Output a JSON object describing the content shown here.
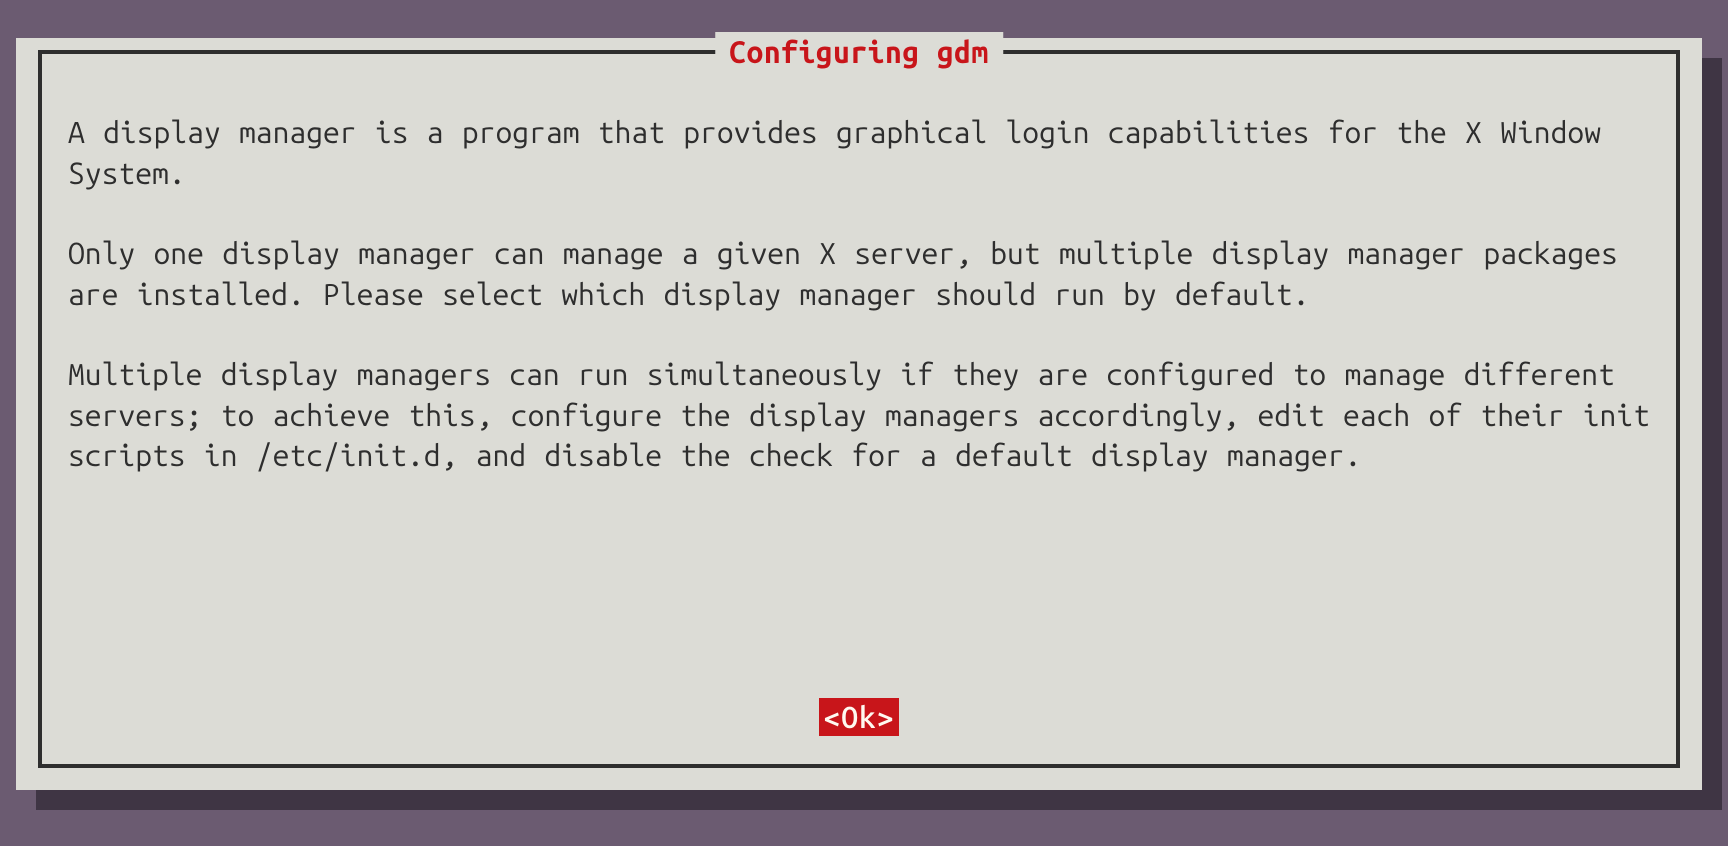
{
  "dialog": {
    "title": "Configuring gdm",
    "paragraphs": [
      "A display manager is a program that provides graphical login capabilities for the X Window System.",
      "Only one display manager can manage a given X server, but multiple display manager packages are installed. Please select which display manager should run by default.",
      "Multiple display managers can run simultaneously if they are configured to manage different servers; to achieve this, configure the display managers accordingly, edit each of their init scripts in /etc/init.d, and disable the check for a default display manager."
    ],
    "ok_label": "<Ok>"
  },
  "colors": {
    "background": "#6b5b71",
    "panel": "#dcdcd6",
    "border": "#2e2e2e",
    "accent": "#c8151a",
    "shadow": "#3f3544"
  }
}
